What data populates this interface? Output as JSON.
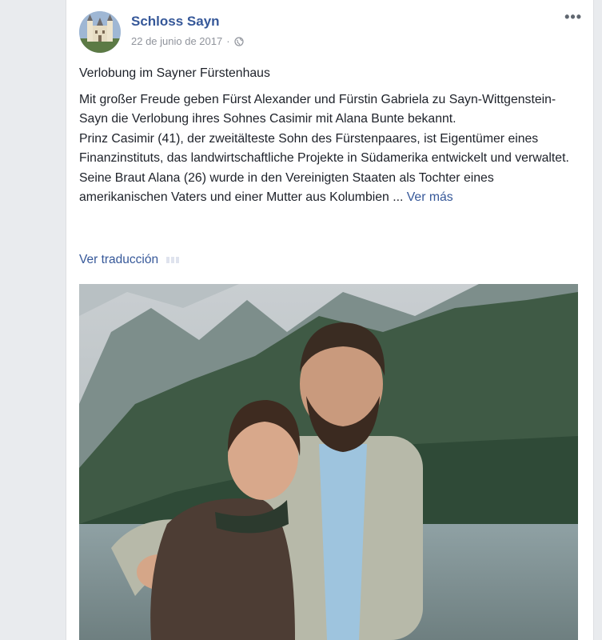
{
  "post": {
    "page_name": "Schloss Sayn",
    "date": "22 de junio de 2017",
    "separator": "·",
    "title": "Verlobung im Sayner Fürstenhaus",
    "paragraph1": "Mit großer Freude geben Fürst Alexander und Fürstin Gabriela zu Sayn-Wittgenstein-Sayn die Verlobung ihres Sohnes Casimir mit Alana Bunte bekannt.",
    "paragraph2": "Prinz Casimir (41), der zweitälteste Sohn des Fürstenpaares, ist Eigentümer eines Finanzinstituts, das landwirtschaftliche Projekte in Südamerika entwickelt und verwaltet.",
    "paragraph3": "Seine Braut Alana (26) wurde in den Vereinigten Staaten als Tochter eines amerikanischen Vaters und einer Mutter aus Kolumbien",
    "ellipsis": " ... ",
    "see_more": "Ver más",
    "translate": "Ver traducción",
    "more_options": "•••"
  },
  "icons": {
    "privacy": "globe-icon",
    "menu": "more-options-icon"
  },
  "colors": {
    "link": "#365899",
    "text": "#1d2129",
    "meta": "#90949c",
    "background": "#e9ebee"
  }
}
